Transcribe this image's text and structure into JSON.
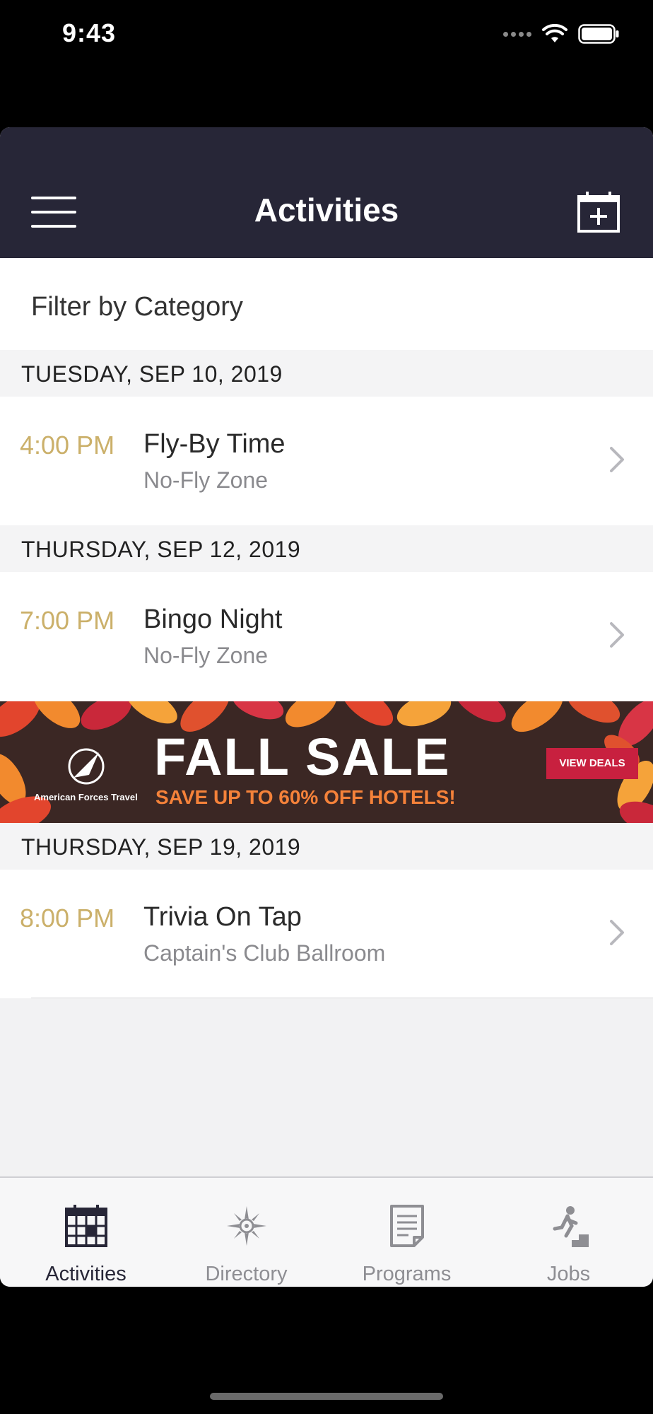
{
  "status_bar": {
    "time": "9:43"
  },
  "header": {
    "title": "Activities"
  },
  "filter": {
    "label": "Filter by Category"
  },
  "sections": [
    {
      "date": "TUESDAY, SEP 10, 2019",
      "event": {
        "time": "4:00 PM",
        "title": "Fly-By Time",
        "location": "No-Fly Zone"
      }
    },
    {
      "date": "THURSDAY, SEP 12, 2019",
      "event": {
        "time": "7:00 PM",
        "title": "Bingo Night",
        "location": "No-Fly Zone"
      }
    },
    {
      "date": "THURSDAY, SEP 19, 2019",
      "event": {
        "time": "8:00 PM",
        "title": "Trivia On Tap",
        "location": "Captain's Club Ballroom"
      }
    }
  ],
  "ad": {
    "brand": "American Forces Travel",
    "headline": "FALL SALE",
    "subline": "SAVE UP TO 60% OFF HOTELS!",
    "cta": "VIEW DEALS"
  },
  "tabs": [
    {
      "label": "Activities",
      "icon": "calendar-grid-icon",
      "active": true
    },
    {
      "label": "Directory",
      "icon": "compass-star-icon",
      "active": false
    },
    {
      "label": "Programs",
      "icon": "document-icon",
      "active": false
    },
    {
      "label": "Jobs",
      "icon": "runner-stairs-icon",
      "active": false
    }
  ],
  "colors": {
    "navbar": "#272637",
    "event_time": "#cbb06a",
    "ad_cta": "#c8203f",
    "ad_subline": "#f5823a"
  }
}
